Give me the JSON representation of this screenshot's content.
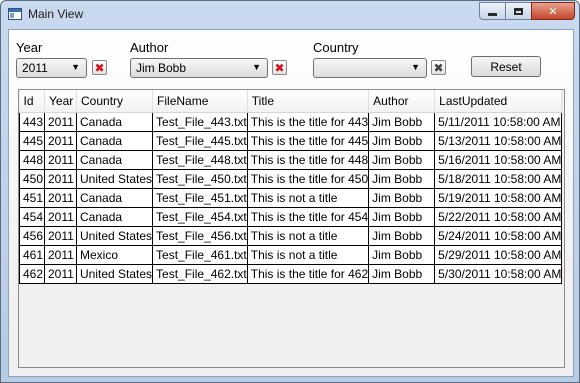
{
  "window": {
    "title": "Main View"
  },
  "filters": {
    "year": {
      "label": "Year",
      "value": "2011"
    },
    "author": {
      "label": "Author",
      "value": "Jim Bobb"
    },
    "country": {
      "label": "Country",
      "value": ""
    },
    "reset_label": "Reset",
    "clear_glyph": "✖"
  },
  "grid": {
    "columns": [
      "Id",
      "Year",
      "Country",
      "FileName",
      "Title",
      "Author",
      "LastUpdated"
    ],
    "rows": [
      [
        "443",
        "2011",
        "Canada",
        "Test_File_443.txt",
        "This is the title for 443",
        "Jim Bobb",
        "5/11/2011 10:58:00 AM"
      ],
      [
        "445",
        "2011",
        "Canada",
        "Test_File_445.txt",
        "This is the title for 445",
        "Jim Bobb",
        "5/13/2011 10:58:00 AM"
      ],
      [
        "448",
        "2011",
        "Canada",
        "Test_File_448.txt",
        "This is the title for 448",
        "Jim Bobb",
        "5/16/2011 10:58:00 AM"
      ],
      [
        "450",
        "2011",
        "United States",
        "Test_File_450.txt",
        "This is the title for 450",
        "Jim Bobb",
        "5/18/2011 10:58:00 AM"
      ],
      [
        "451",
        "2011",
        "Canada",
        "Test_File_451.txt",
        "This is not a title",
        "Jim Bobb",
        "5/19/2011 10:58:00 AM"
      ],
      [
        "454",
        "2011",
        "Canada",
        "Test_File_454.txt",
        "This is the title for 454",
        "Jim Bobb",
        "5/22/2011 10:58:00 AM"
      ],
      [
        "456",
        "2011",
        "United States",
        "Test_File_456.txt",
        "This is not a title",
        "Jim Bobb",
        "5/24/2011 10:58:00 AM"
      ],
      [
        "461",
        "2011",
        "Mexico",
        "Test_File_461.txt",
        "This is not a title",
        "Jim Bobb",
        "5/29/2011 10:58:00 AM"
      ],
      [
        "462",
        "2011",
        "United States",
        "Test_File_462.txt",
        "This is the title for 462",
        "Jim Bobb",
        "5/30/2011 10:58:00 AM"
      ]
    ]
  }
}
